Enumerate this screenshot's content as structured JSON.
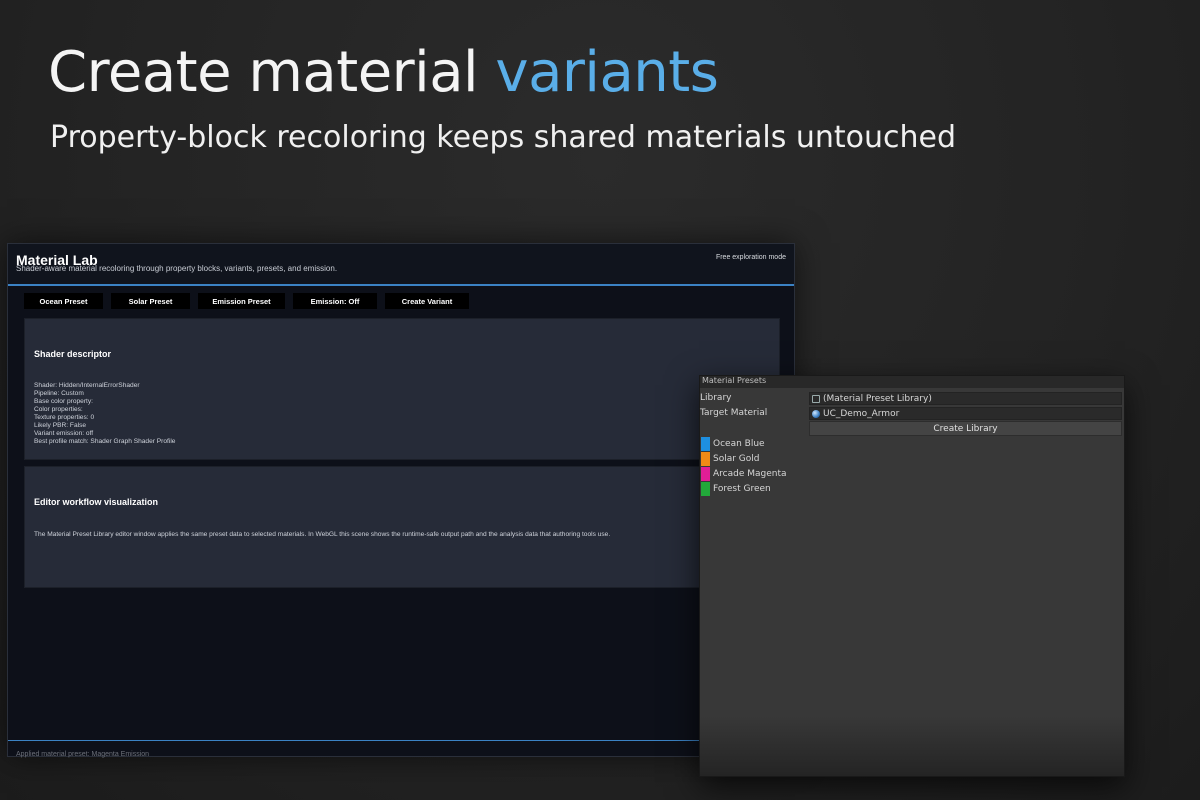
{
  "hero": {
    "title_main": "Create material ",
    "title_accent": "variants",
    "subtitle": "Property-block recoloring keeps shared materials untouched",
    "accent_color": "#5aaee8"
  },
  "material_lab": {
    "title": "Material Lab",
    "description": "Shader-aware material recoloring through property blocks, variants, presets, and emission.",
    "mode": "Free exploration mode",
    "toolbar": [
      {
        "label": "Ocean Preset"
      },
      {
        "label": "Solar Preset"
      },
      {
        "label": "Emission Preset"
      },
      {
        "label": "Emission: Off"
      },
      {
        "label": "Create Variant"
      }
    ],
    "shader_card": {
      "heading": "Shader descriptor",
      "lines": [
        "Shader: Hidden/InternalErrorShader",
        "Pipeline: Custom",
        "Base color property:",
        "Color properties:",
        "Texture properties: 0",
        "Likely PBR: False",
        "Variant emission: off",
        "Best profile match: Shader Graph Shader Profile"
      ]
    },
    "workflow_card": {
      "heading": "Editor workflow visualization",
      "text": "The Material Preset Library editor window applies the same preset data to selected materials. In WebGL this scene shows the runtime-safe output path and the analysis data that authoring tools use."
    },
    "footer_status": "Applied material preset: Magenta Emission",
    "accent_color": "#3b82c4"
  },
  "presets_window": {
    "tab_title": "Material Presets",
    "library_label": "Library",
    "library_value": "(Material Preset Library)",
    "target_label": "Target Material",
    "target_value": "UC_Demo_Armor",
    "create_button": "Create Library",
    "presets": [
      {
        "name": "Ocean Blue",
        "color": "#1e8fe0"
      },
      {
        "name": "Solar Gold",
        "color": "#f08a16"
      },
      {
        "name": "Arcade Magenta",
        "color": "#e01e96"
      },
      {
        "name": "Forest Green",
        "color": "#22a83a"
      }
    ]
  }
}
